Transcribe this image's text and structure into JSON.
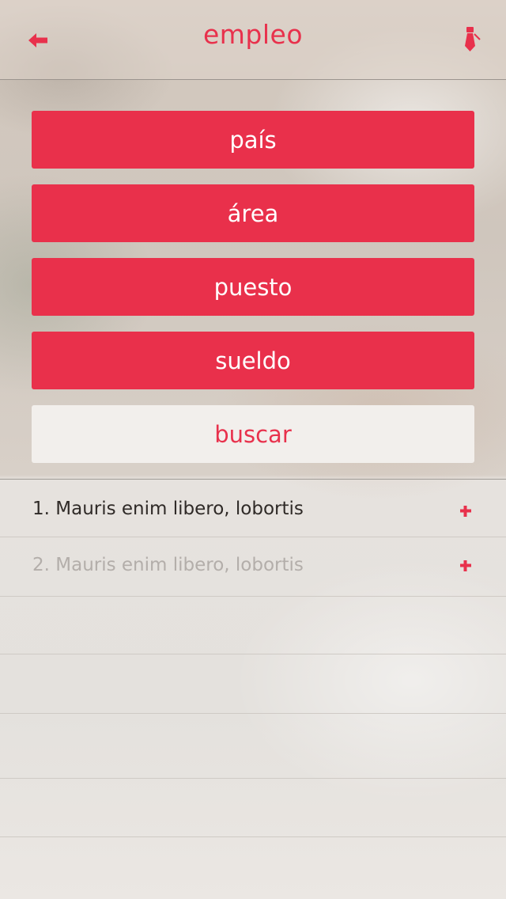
{
  "header": {
    "title": "empleo",
    "back_icon": "arrow-left-icon",
    "profile_icon": "necktie-icon"
  },
  "filters": [
    {
      "label": "país"
    },
    {
      "label": "área"
    },
    {
      "label": "puesto"
    },
    {
      "label": "sueldo"
    }
  ],
  "search": {
    "label": "buscar"
  },
  "results": [
    {
      "text": "1. Mauris enim libero, lobortis",
      "action_icon": "plus-icon"
    },
    {
      "text": "2. Mauris enim libero, lobortis",
      "action_icon": "plus-icon"
    }
  ],
  "colors": {
    "accent": "#e9304b",
    "search_bg": "#f2efec",
    "row_text_primary": "#2f2a27",
    "row_text_muted": "#b3aeaa"
  }
}
